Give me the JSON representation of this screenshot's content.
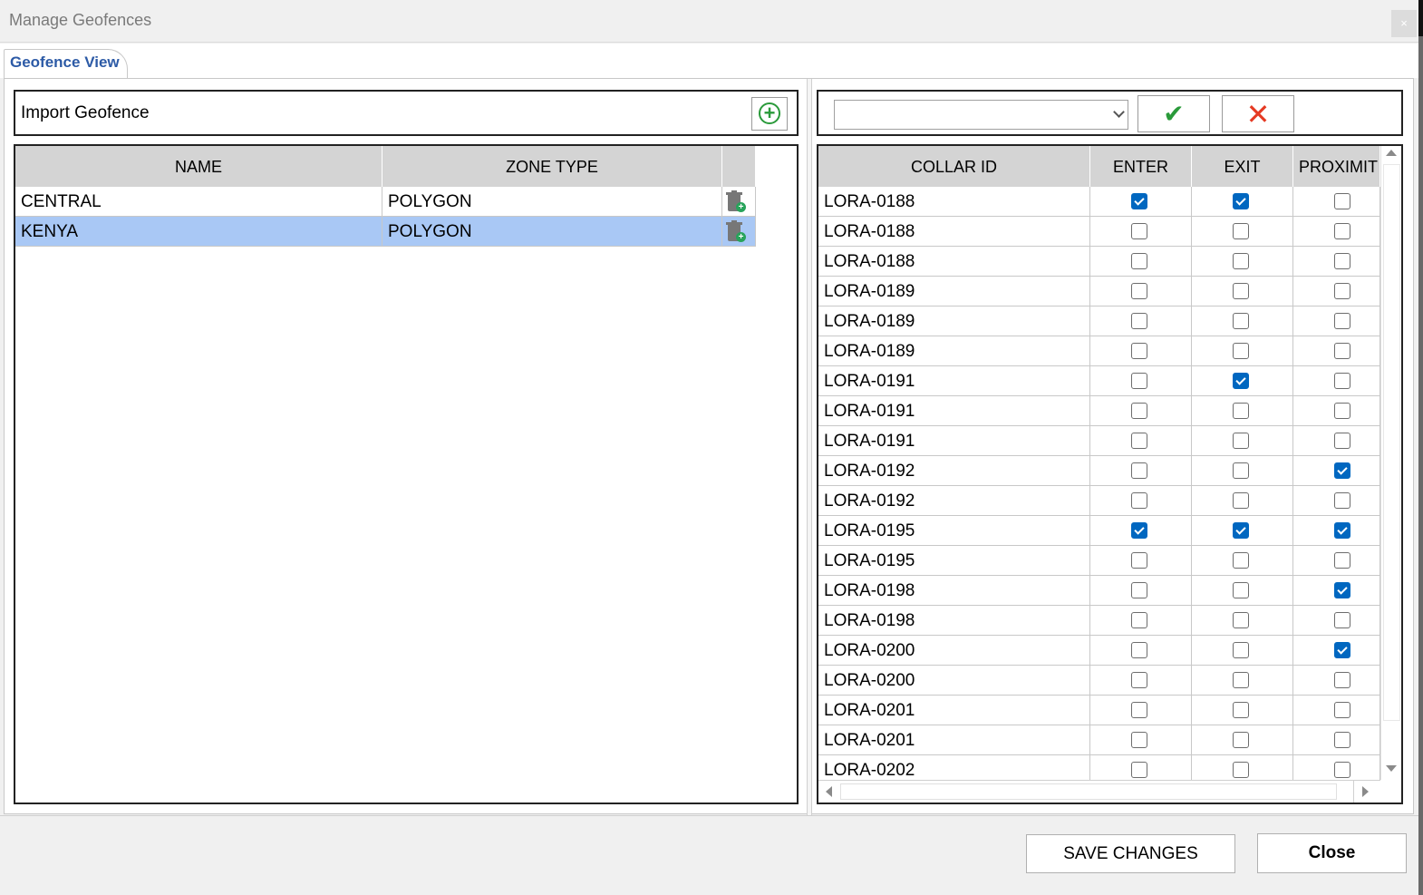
{
  "window": {
    "title": "Manage Geofences",
    "close_glyph": "×"
  },
  "tabs": [
    {
      "label": "Geofence View"
    }
  ],
  "import": {
    "label": "Import Geofence",
    "add_icon": "add-circle-icon"
  },
  "geofence_table": {
    "columns": [
      "NAME",
      "ZONE TYPE"
    ],
    "rows": [
      {
        "name": "CENTRAL",
        "zone_type": "POLYGON",
        "selected": false
      },
      {
        "name": "KENYA",
        "zone_type": "POLYGON",
        "selected": true
      }
    ]
  },
  "filter": {
    "value": "",
    "confirm_icon": "checkmark-icon",
    "cancel_icon": "red-x-icon",
    "confirm_glyph": "✔",
    "cancel_glyph": "✕"
  },
  "collar_table": {
    "columns": [
      "COLLAR ID",
      "ENTER",
      "EXIT",
      "PROXIMIT"
    ],
    "rows": [
      {
        "id": "LORA-0188",
        "enter": true,
        "exit": true,
        "proximity": false
      },
      {
        "id": "LORA-0188",
        "enter": false,
        "exit": false,
        "proximity": false
      },
      {
        "id": "LORA-0188",
        "enter": false,
        "exit": false,
        "proximity": false
      },
      {
        "id": "LORA-0189",
        "enter": false,
        "exit": false,
        "proximity": false
      },
      {
        "id": "LORA-0189",
        "enter": false,
        "exit": false,
        "proximity": false
      },
      {
        "id": "LORA-0189",
        "enter": false,
        "exit": false,
        "proximity": false
      },
      {
        "id": "LORA-0191",
        "enter": false,
        "exit": true,
        "proximity": false
      },
      {
        "id": "LORA-0191",
        "enter": false,
        "exit": false,
        "proximity": false
      },
      {
        "id": "LORA-0191",
        "enter": false,
        "exit": false,
        "proximity": false
      },
      {
        "id": "LORA-0192",
        "enter": false,
        "exit": false,
        "proximity": true
      },
      {
        "id": "LORA-0192",
        "enter": false,
        "exit": false,
        "proximity": false
      },
      {
        "id": "LORA-0195",
        "enter": true,
        "exit": true,
        "proximity": true
      },
      {
        "id": "LORA-0195",
        "enter": false,
        "exit": false,
        "proximity": false
      },
      {
        "id": "LORA-0198",
        "enter": false,
        "exit": false,
        "proximity": true
      },
      {
        "id": "LORA-0198",
        "enter": false,
        "exit": false,
        "proximity": false
      },
      {
        "id": "LORA-0200",
        "enter": false,
        "exit": false,
        "proximity": true
      },
      {
        "id": "LORA-0200",
        "enter": false,
        "exit": false,
        "proximity": false
      },
      {
        "id": "LORA-0201",
        "enter": false,
        "exit": false,
        "proximity": false
      },
      {
        "id": "LORA-0201",
        "enter": false,
        "exit": false,
        "proximity": false
      },
      {
        "id": "LORA-0202",
        "enter": false,
        "exit": false,
        "proximity": false
      }
    ]
  },
  "footer": {
    "save_label": "SAVE CHANGES",
    "close_label": "Close"
  },
  "colors": {
    "accent_blue": "#0067c0",
    "selected_row": "#a9c8f5",
    "tab_text": "#2c5aa6",
    "confirm_green": "#2a9a3a",
    "cancel_red": "#e53a23"
  }
}
